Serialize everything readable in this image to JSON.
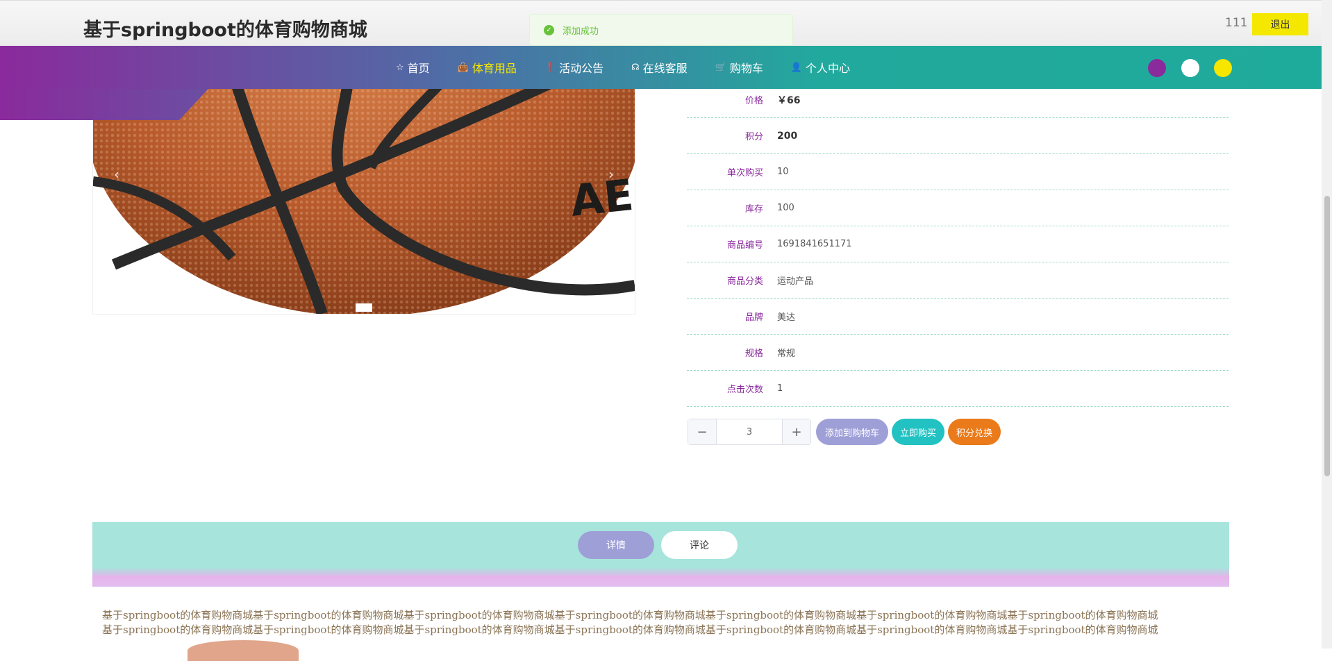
{
  "header": {
    "title": "基于springboot的体育购物商城",
    "username": "111",
    "logout_label": "退出"
  },
  "toast": {
    "message": "添加成功",
    "icon": "check-circle-icon"
  },
  "nav": {
    "items": [
      {
        "label": "首页",
        "icon": "star-icon",
        "active": false
      },
      {
        "label": "体育用品",
        "icon": "bag-icon",
        "active": true
      },
      {
        "label": "活动公告",
        "icon": "info-icon",
        "active": false
      },
      {
        "label": "在线客服",
        "icon": "headset-icon",
        "active": false
      },
      {
        "label": "购物车",
        "icon": "cart-icon",
        "active": false
      },
      {
        "label": "个人中心",
        "icon": "user-icon",
        "active": false
      }
    ],
    "theme_dots": [
      "#8a2a9c",
      "#ffffff",
      "#f7e600"
    ]
  },
  "product": {
    "fields": [
      {
        "label": "价格",
        "value": "￥66",
        "bold": true
      },
      {
        "label": "积分",
        "value": "200",
        "bold": true
      },
      {
        "label": "单次购买",
        "value": "10"
      },
      {
        "label": "库存",
        "value": "100"
      },
      {
        "label": "商品编号",
        "value": "1691841651171"
      },
      {
        "label": "商品分类",
        "value": "运动产品"
      },
      {
        "label": "品牌",
        "value": "美达"
      },
      {
        "label": "规格",
        "value": "常规"
      },
      {
        "label": "点击次数",
        "value": "1"
      }
    ],
    "quantity": "3",
    "buttons": {
      "add_to_cart": "添加到购物车",
      "buy_now": "立即购买",
      "redeem_points": "积分兑换"
    }
  },
  "tabs": {
    "detail_label": "详情",
    "comments_label": "评论"
  },
  "description": {
    "line1": "基于springboot的体育购物商城基于springboot的体育购物商城基于springboot的体育购物商城基于springboot的体育购物商城基于springboot的体育购物商城基于springboot的体育购物商城基于springboot的体育购物商城",
    "line2": "基于springboot的体育购物商城基于springboot的体育购物商城基于springboot的体育购物商城基于springboot的体育购物商城基于springboot的体育购物商城基于springboot的体育购物商城基于springboot的体育购物商城"
  },
  "colors": {
    "accent_teal": "#1fab9b",
    "accent_purple": "#8a2a9c",
    "accent_yellow": "#f5e800",
    "button_lavender": "#9f9fd8",
    "button_teal": "#22c2c2",
    "button_orange": "#ea7a1a"
  }
}
